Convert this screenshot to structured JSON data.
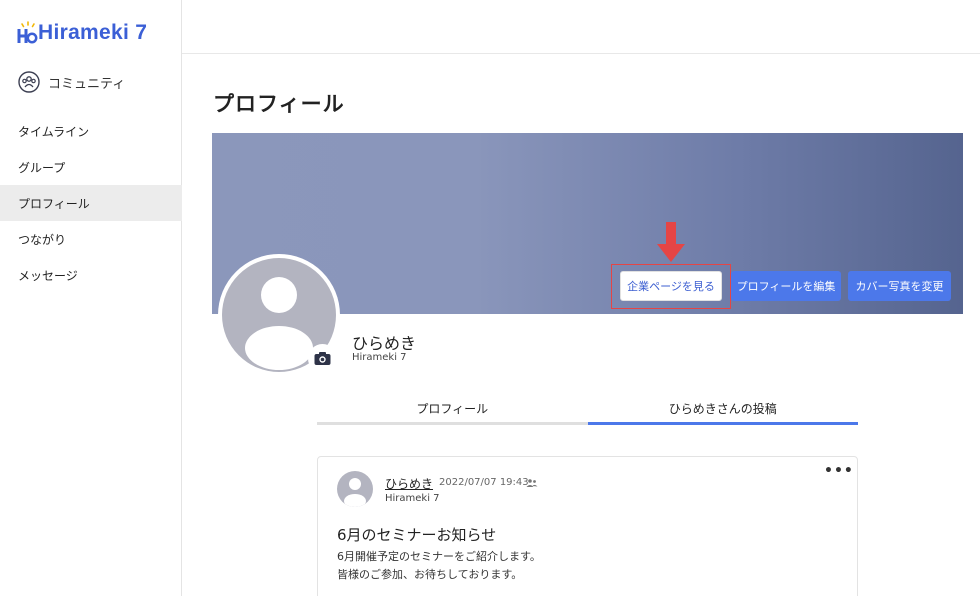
{
  "app": {
    "logo_text": "Hirameki 7"
  },
  "sidebar": {
    "community_label": "コミュニティ",
    "items": [
      {
        "label": "タイムライン",
        "active": false
      },
      {
        "label": "グループ",
        "active": false
      },
      {
        "label": "プロフィール",
        "active": true
      },
      {
        "label": "つながり",
        "active": false
      },
      {
        "label": "メッセージ",
        "active": false
      }
    ]
  },
  "page": {
    "title": "プロフィール"
  },
  "cover": {
    "company_page_button": "企業ページを見る",
    "edit_profile_button": "プロフィールを編集",
    "change_cover_button": "カバー写真を変更"
  },
  "profile": {
    "name": "ひらめき",
    "company": "Hirameki 7"
  },
  "tabs": [
    {
      "label": "プロフィール",
      "active": false
    },
    {
      "label": "ひらめきさんの投稿",
      "active": true
    }
  ],
  "post": {
    "author": "ひらめき",
    "datetime": "2022/07/07 19:43",
    "company": "Hirameki 7",
    "more": "•••",
    "title": "6月のセミナーお知らせ",
    "body_line1": "6月開催予定のセミナーをご紹介します。",
    "body_line2": "皆様のご参加、お待ちしております。"
  },
  "colors": {
    "accent": "#4c78ea",
    "brand": "#3b5fd6",
    "highlight": "#e54545"
  }
}
